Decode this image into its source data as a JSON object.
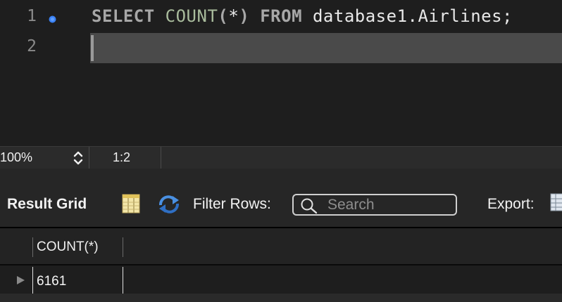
{
  "editor": {
    "lines": [
      {
        "number": "1",
        "tokens": {
          "select": "SELECT",
          "count": "COUNT",
          "paren_open": "(",
          "star": "*",
          "paren_close": ")",
          "from": "FROM",
          "table": "database1.Airlines;"
        }
      },
      {
        "number": "2"
      }
    ],
    "colors": {
      "keyword": "#a7a7a7",
      "function": "#a9bc9c",
      "breakpoint": "#3b82f6"
    }
  },
  "statusbar": {
    "zoom": "100%",
    "cursor_position": "1:2"
  },
  "result_toolbar": {
    "title": "Result Grid",
    "filter_label": "Filter Rows:",
    "search_placeholder": "Search",
    "export_label": "Export:"
  },
  "result_grid": {
    "columns": [
      "COUNT(*)"
    ],
    "rows": [
      [
        "6161"
      ]
    ]
  },
  "icons": {
    "grid": "grid-layout-icon",
    "refresh": "refresh-icon",
    "search": "search-icon",
    "export": "export-icon",
    "row_indicator": "row-arrow-icon"
  }
}
